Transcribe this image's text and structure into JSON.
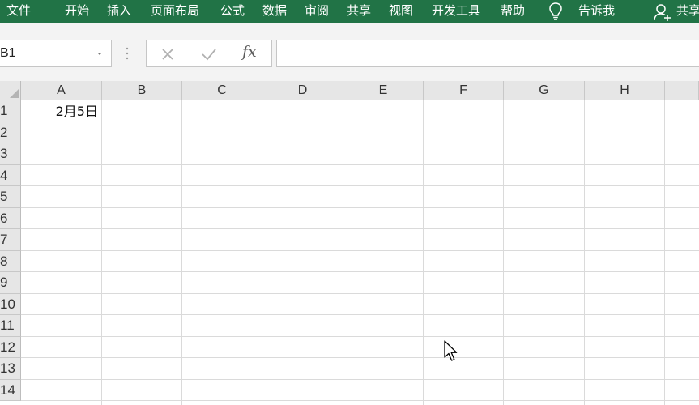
{
  "ribbon": {
    "tabs": [
      {
        "label": "文件",
        "name": "tab-file"
      },
      {
        "label": "开始",
        "name": "tab-home"
      },
      {
        "label": "插入",
        "name": "tab-insert"
      },
      {
        "label": "页面布局",
        "name": "tab-page-layout"
      },
      {
        "label": "公式",
        "name": "tab-formulas"
      },
      {
        "label": "数据",
        "name": "tab-data"
      },
      {
        "label": "审阅",
        "name": "tab-review"
      },
      {
        "label": "共享",
        "name": "tab-share-menu"
      },
      {
        "label": "视图",
        "name": "tab-view"
      },
      {
        "label": "开发工具",
        "name": "tab-developer"
      },
      {
        "label": "帮助",
        "name": "tab-help"
      }
    ],
    "tell_me": "告诉我",
    "share": "共享",
    "tell_me_icon": "lightbulb-icon",
    "share_icon": "add-user-icon",
    "color": "#217346"
  },
  "formula_bar": {
    "name_box": "B1",
    "cancel_icon": "close-icon",
    "enter_icon": "check-icon",
    "fx_label": "fx",
    "formula": ""
  },
  "grid": {
    "columns": [
      "A",
      "B",
      "C",
      "D",
      "E",
      "F",
      "G",
      "H"
    ],
    "rows": [
      "1",
      "2",
      "3",
      "4",
      "5",
      "6",
      "7",
      "8",
      "9",
      "10",
      "11",
      "12",
      "13",
      "14"
    ],
    "cells": {
      "A1": "2月5日"
    }
  }
}
